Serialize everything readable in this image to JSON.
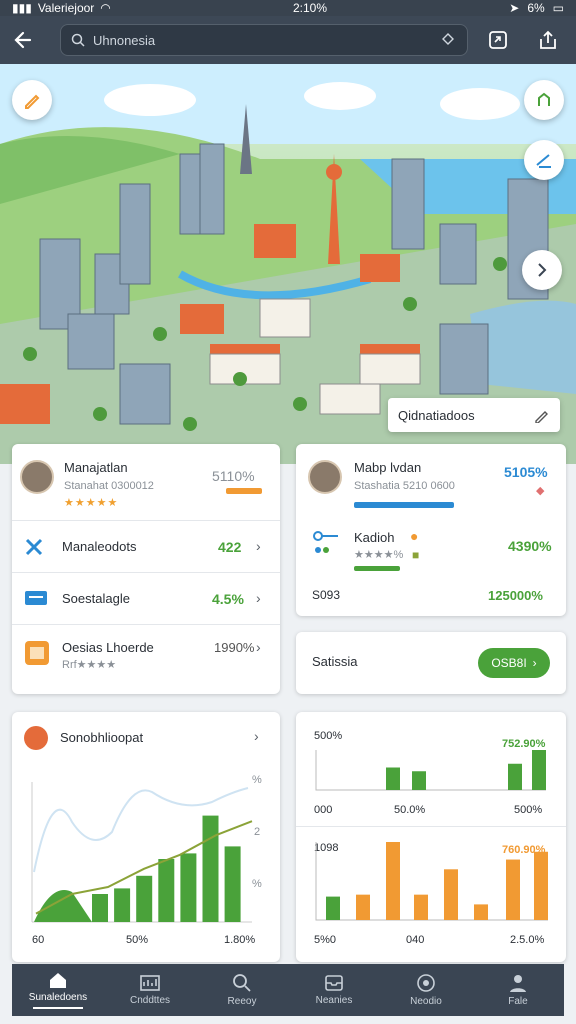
{
  "status_bar": {
    "carrier": "Valeriejoor",
    "time": "2:10%",
    "battery": "6%"
  },
  "topbar": {
    "search_value": "Uhnonesia"
  },
  "map": {
    "tooltip": "Qidnatiadoos"
  },
  "card_left": {
    "header": {
      "name": "Manajatlan",
      "sub": "Stanahat 0300012",
      "value": "5110%",
      "rating": 4
    },
    "items": [
      {
        "label": "Manaleodots",
        "value": "422"
      },
      {
        "label": "Soestalagle",
        "value": "4.5%"
      },
      {
        "label": "Oesias Lhoerde",
        "sub": "Rrf★★★★",
        "value": "1990%"
      }
    ]
  },
  "card_right": {
    "header": {
      "name": "Mabp lvdan",
      "sub": "Stashatia 5210 0600",
      "value": "5105%"
    },
    "detail": {
      "label": "Kadioh",
      "sub": "★★★★%",
      "value": "4390%"
    },
    "foot_left": "S093",
    "foot_right": "125000%"
  },
  "satisfaction": {
    "label": "Satissia",
    "button": "OSB8I"
  },
  "chart_left": {
    "title": "Sonobhlioopat",
    "y_labels": [
      "%",
      "2",
      "%"
    ],
    "x_labels": [
      "60",
      "50%",
      "1.80%"
    ]
  },
  "chart_data": [
    {
      "type": "bar",
      "title": "Sonobhlioopat",
      "values": [
        20,
        24,
        33,
        45,
        49,
        76,
        54
      ],
      "line": [
        6,
        20,
        25,
        38,
        48,
        62,
        72
      ]
    },
    {
      "type": "bar",
      "title": "500%",
      "values": [
        36,
        30,
        42,
        64
      ],
      "top_right": "752.90%",
      "x_labels": [
        "000",
        "50.0%",
        "500%"
      ]
    },
    {
      "type": "bar",
      "title": "1098",
      "values": [
        24,
        26,
        80,
        26,
        52,
        16,
        62,
        70
      ],
      "top_right": "760.90%",
      "x_labels": [
        "5%0",
        "040",
        "2.5.0%"
      ]
    }
  ],
  "chart_right": {
    "top_title": "500%",
    "top_value": "752.90%",
    "top_x": [
      "000",
      "50.0%",
      "500%"
    ],
    "bottom_title": "1098",
    "bottom_value": "760.90%",
    "bottom_x": [
      "5%0",
      "040",
      "2.5.0%"
    ]
  },
  "nav": [
    {
      "label": "Sunaledoens",
      "icon": "home-icon"
    },
    {
      "label": "Cnddttes",
      "icon": "chart-icon"
    },
    {
      "label": "Reeoy",
      "icon": "search-icon"
    },
    {
      "label": "Neanies",
      "icon": "inbox-icon"
    },
    {
      "label": "Neodio",
      "icon": "target-icon"
    },
    {
      "label": "Fale",
      "icon": "user-icon"
    }
  ],
  "colors": {
    "green": "#4aa23a",
    "orange": "#f19a33",
    "blue": "#2b8ad3",
    "navbar": "#3a4553"
  }
}
